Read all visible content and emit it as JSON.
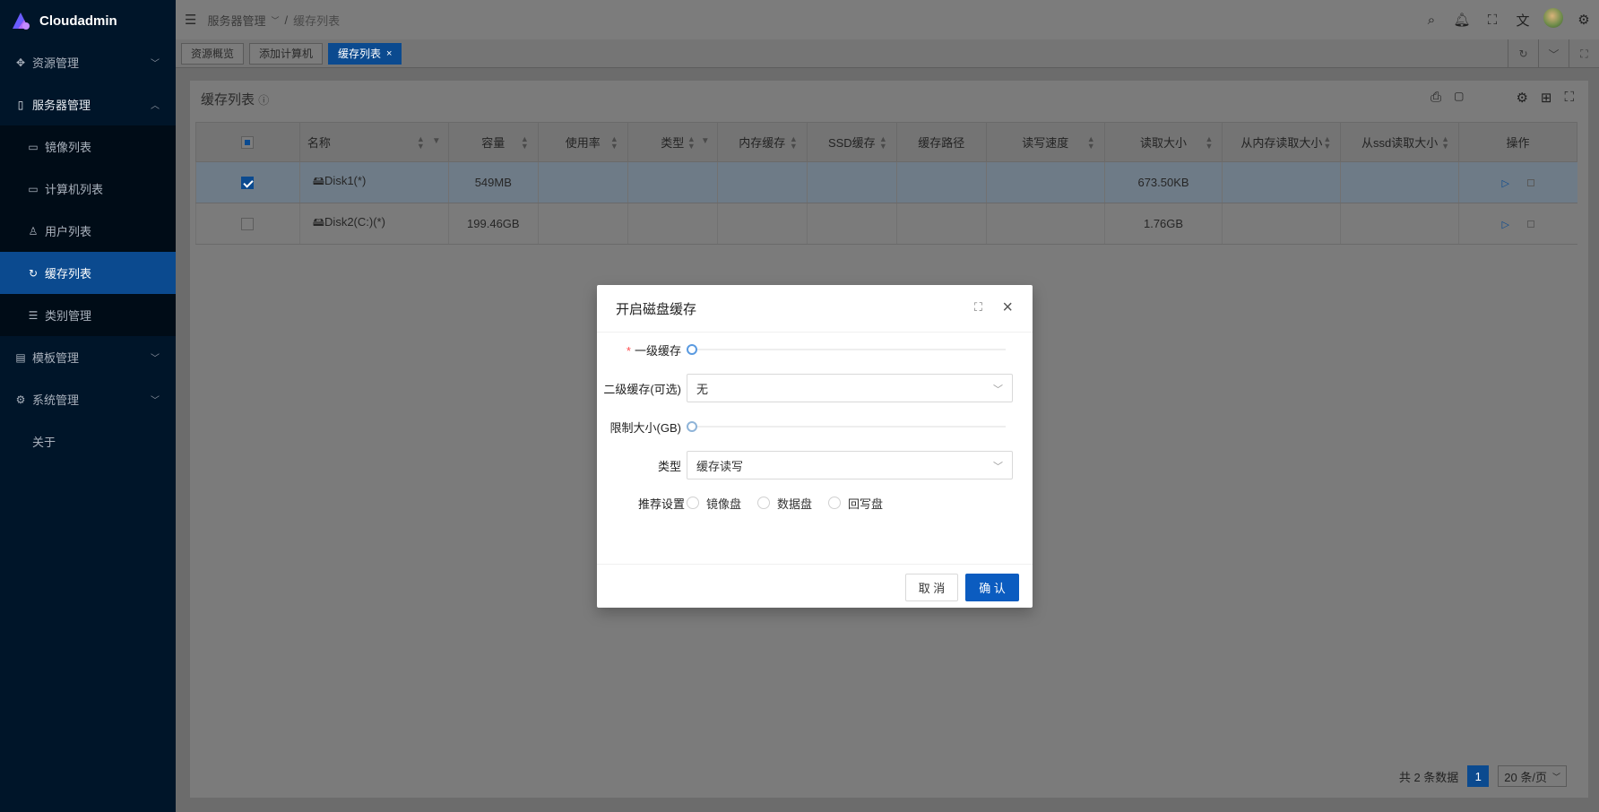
{
  "app": {
    "name": "Cloudadmin"
  },
  "sidebar": {
    "items": [
      {
        "label": "资源管理",
        "icon": "resource-icon"
      },
      {
        "label": "服务器管理",
        "icon": "server-icon"
      },
      {
        "label": "镜像列表",
        "icon": "image-icon"
      },
      {
        "label": "计算机列表",
        "icon": "computer-icon"
      },
      {
        "label": "用户列表",
        "icon": "user-icon"
      },
      {
        "label": "缓存列表",
        "icon": "cache-icon"
      },
      {
        "label": "类别管理",
        "icon": "category-icon"
      },
      {
        "label": "模板管理",
        "icon": "template-icon"
      },
      {
        "label": "系统管理",
        "icon": "system-icon"
      },
      {
        "label": "关于",
        "icon": ""
      }
    ]
  },
  "breadcrumb": {
    "parent": "服务器管理",
    "current": "缓存列表"
  },
  "tabs": [
    {
      "label": "资源概览"
    },
    {
      "label": "添加计算机"
    },
    {
      "label": "缓存列表"
    }
  ],
  "card": {
    "title": "缓存列表"
  },
  "table": {
    "headers": [
      "名称",
      "容量",
      "使用率",
      "类型",
      "内存缓存",
      "SSD缓存",
      "缓存路径",
      "读写速度",
      "读取大小",
      "从内存读取大小",
      "从ssd读取大小",
      "操作"
    ],
    "rows": [
      {
        "name": "Disk1(*)",
        "capacity": "549MB",
        "read_size": "673.50KB",
        "selected": true
      },
      {
        "name": "Disk2(C:)(*)",
        "capacity": "199.46GB",
        "read_size": "1.76GB",
        "selected": false
      }
    ]
  },
  "pagination": {
    "total": "共 2 条数据",
    "page": "1",
    "page_size": "20 条/页"
  },
  "modal": {
    "title": "开启磁盘缓存",
    "fields": {
      "level1": {
        "label": "一级缓存",
        "required": true,
        "value": 0
      },
      "level2": {
        "label": "二级缓存(可选)",
        "value": "无"
      },
      "limit": {
        "label": "限制大小(GB)",
        "value": 0
      },
      "type": {
        "label": "类型",
        "value": "缓存读写"
      },
      "recommend": {
        "label": "推荐设置",
        "options": [
          "镜像盘",
          "数据盘",
          "回写盘"
        ]
      }
    },
    "cancel": "取 消",
    "ok": "确 认"
  },
  "colors": {
    "sidebar": "#001529",
    "accent": "#0b4a8f",
    "primary_button": "#0b5cc0"
  }
}
